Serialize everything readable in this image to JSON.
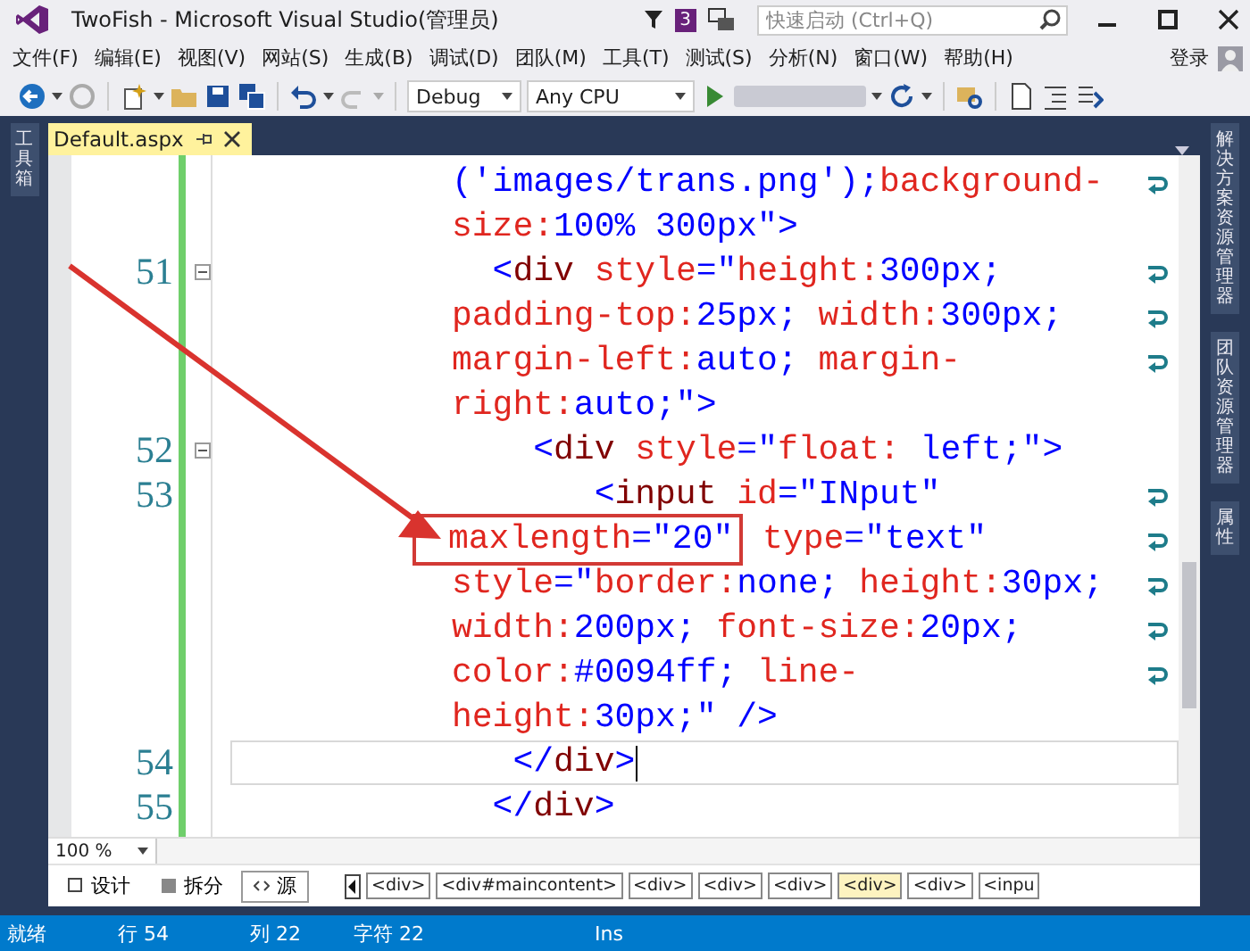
{
  "window": {
    "title": "TwoFish - Microsoft Visual Studio(管理员)",
    "notification_count": "3",
    "quick_launch": {
      "placeholder": "快速启动 (Ctrl+Q)"
    }
  },
  "menu": {
    "items": [
      "文件(F)",
      "编辑(E)",
      "视图(V)",
      "网站(S)",
      "生成(B)",
      "调试(D)",
      "团队(M)",
      "工具(T)",
      "测试(S)",
      "分析(N)",
      "窗口(W)",
      "帮助(H)"
    ],
    "sign_in": "登录"
  },
  "toolbar": {
    "configuration": "Debug",
    "platform": "Any CPU"
  },
  "left_panel": {
    "tabs": [
      "工具箱"
    ]
  },
  "right_panel": {
    "tabs": [
      "解决方案资源管理器",
      "团队资源管理器",
      "属性"
    ]
  },
  "document_tabs": [
    {
      "label": "Default.aspx",
      "selected": true
    }
  ],
  "editor": {
    "lines": [
      {
        "wrapped": true,
        "current": false,
        "segments": [
          {
            "kind": "value",
            "text": "('images/trans.png');"
          },
          {
            "kind": "attr",
            "text": "background-"
          }
        ]
      },
      {
        "wrapped": false,
        "current": false,
        "segments": [
          {
            "kind": "attr",
            "text": "size:"
          },
          {
            "kind": "value",
            "text": "100% 300px\""
          },
          {
            "kind": "delim",
            "text": ">"
          }
        ]
      },
      {
        "number": "51",
        "fold": true,
        "wrapped": true,
        "current": false,
        "segments": [
          {
            "kind": "delim",
            "text": "  <"
          },
          {
            "kind": "tag",
            "text": "div"
          },
          {
            "kind": "attr",
            "text": " style"
          },
          {
            "kind": "delim",
            "text": "="
          },
          {
            "kind": "value",
            "text": "\""
          },
          {
            "kind": "attr",
            "text": "height:"
          },
          {
            "kind": "value",
            "text": "300px;"
          }
        ]
      },
      {
        "wrapped": true,
        "current": false,
        "segments": [
          {
            "kind": "attr",
            "text": "padding-top:"
          },
          {
            "kind": "value",
            "text": "25px;"
          },
          {
            "kind": "attr",
            "text": " width:"
          },
          {
            "kind": "value",
            "text": "300px;"
          }
        ]
      },
      {
        "wrapped": true,
        "current": false,
        "segments": [
          {
            "kind": "attr",
            "text": "margin-left:"
          },
          {
            "kind": "value",
            "text": "auto;"
          },
          {
            "kind": "attr",
            "text": " margin-"
          }
        ]
      },
      {
        "wrapped": false,
        "current": false,
        "segments": [
          {
            "kind": "attr",
            "text": "right:"
          },
          {
            "kind": "value",
            "text": "auto;\""
          },
          {
            "kind": "delim",
            "text": ">"
          }
        ]
      },
      {
        "number": "52",
        "fold": true,
        "wrapped": false,
        "current": false,
        "segments": [
          {
            "kind": "delim",
            "text": "    <"
          },
          {
            "kind": "tag",
            "text": "div"
          },
          {
            "kind": "attr",
            "text": " style"
          },
          {
            "kind": "delim",
            "text": "="
          },
          {
            "kind": "value",
            "text": "\""
          },
          {
            "kind": "attr",
            "text": "float:"
          },
          {
            "kind": "value",
            "text": " left;\""
          },
          {
            "kind": "delim",
            "text": ">"
          }
        ]
      },
      {
        "number": "53",
        "wrapped": true,
        "current": false,
        "segments": [
          {
            "kind": "delim",
            "text": "       <"
          },
          {
            "kind": "tag",
            "text": "input"
          },
          {
            "kind": "attr",
            "text": " id"
          },
          {
            "kind": "delim",
            "text": "="
          },
          {
            "kind": "value",
            "text": "\"INput\""
          }
        ]
      },
      {
        "wrapped": true,
        "current": false,
        "segments": [
          {
            "kind": "attr",
            "text": "maxlength",
            "boxed": true
          },
          {
            "kind": "delim",
            "text": "=",
            "boxed": true
          },
          {
            "kind": "value",
            "text": "\"20\"",
            "boxed": true
          },
          {
            "kind": "attr",
            "text": " type"
          },
          {
            "kind": "delim",
            "text": "="
          },
          {
            "kind": "value",
            "text": "\"text\""
          }
        ]
      },
      {
        "wrapped": true,
        "current": false,
        "segments": [
          {
            "kind": "attr",
            "text": "style"
          },
          {
            "kind": "delim",
            "text": "="
          },
          {
            "kind": "value",
            "text": "\""
          },
          {
            "kind": "attr",
            "text": "border:"
          },
          {
            "kind": "value",
            "text": "none;"
          },
          {
            "kind": "attr",
            "text": " height:"
          },
          {
            "kind": "value",
            "text": "30px;"
          }
        ]
      },
      {
        "wrapped": true,
        "current": false,
        "segments": [
          {
            "kind": "attr",
            "text": "width:"
          },
          {
            "kind": "value",
            "text": "200px;"
          },
          {
            "kind": "attr",
            "text": " font-size:"
          },
          {
            "kind": "value",
            "text": "20px;"
          }
        ]
      },
      {
        "wrapped": true,
        "current": false,
        "segments": [
          {
            "kind": "attr",
            "text": "color:"
          },
          {
            "kind": "value",
            "text": "#0094ff;"
          },
          {
            "kind": "attr",
            "text": " line-"
          }
        ]
      },
      {
        "wrapped": false,
        "current": false,
        "segments": [
          {
            "kind": "attr",
            "text": "height:"
          },
          {
            "kind": "value",
            "text": "30px;\""
          },
          {
            "kind": "delim",
            "text": " />"
          }
        ]
      },
      {
        "number": "54",
        "wrapped": false,
        "current": true,
        "segments": [
          {
            "kind": "delim",
            "text": "   </"
          },
          {
            "kind": "tag",
            "text": "div"
          },
          {
            "kind": "delim",
            "text": ">"
          }
        ]
      },
      {
        "number": "55",
        "wrapped": false,
        "current": false,
        "segments": [
          {
            "kind": "delim",
            "text": "  </"
          },
          {
            "kind": "tag",
            "text": "div"
          },
          {
            "kind": "delim",
            "text": ">"
          }
        ]
      }
    ]
  },
  "zoom": "100 %",
  "view_buttons": [
    {
      "label": "设计",
      "selected": false
    },
    {
      "label": "拆分",
      "selected": false
    },
    {
      "label": "源",
      "selected": true
    }
  ],
  "breadcrumb": [
    {
      "label": "<div>",
      "selected": false
    },
    {
      "label": "<div#maincontent>",
      "selected": false
    },
    {
      "label": "<div>",
      "selected": false
    },
    {
      "label": "<div>",
      "selected": false
    },
    {
      "label": "<div>",
      "selected": false
    },
    {
      "label": "<div>",
      "selected": true
    },
    {
      "label": "<div>",
      "selected": false
    },
    {
      "label": "<inpu",
      "selected": false
    }
  ],
  "status_bar": {
    "state": "就绪",
    "line": "行 54",
    "column": "列 22",
    "char": "字符 22",
    "mode": "Ins"
  }
}
